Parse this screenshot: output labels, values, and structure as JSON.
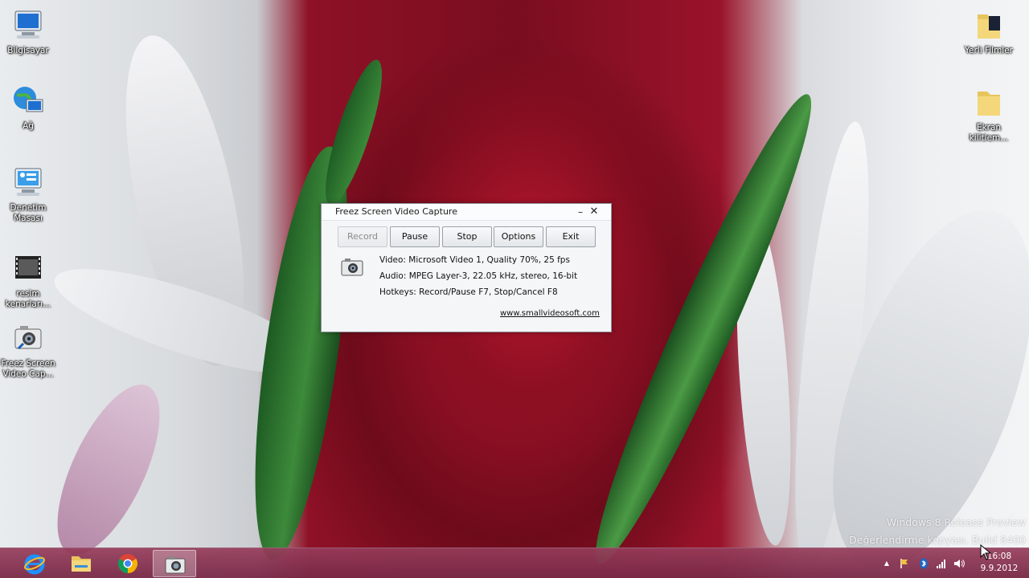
{
  "desktop": {
    "icons_left": [
      {
        "label": "Bilgisayar",
        "icon": "computer-icon"
      },
      {
        "label": "Ağ",
        "icon": "network-globe-icon"
      },
      {
        "label": "Denetim\nMasası",
        "icon": "control-panel-icon"
      },
      {
        "label": "resim\nkenarları...",
        "icon": "video-file-icon"
      },
      {
        "label": "Freez Screen\nVideo Cap...",
        "icon": "camera-app-icon"
      }
    ],
    "icons_right": [
      {
        "label": "Yerli Filmler",
        "icon": "folder-icon"
      },
      {
        "label": "Ekran\nkilitlem...",
        "icon": "folder-icon"
      }
    ]
  },
  "dialog": {
    "title": "Freez Screen Video Capture",
    "minimize_symbol": "–",
    "close_symbol": "✕",
    "buttons": {
      "record": "Record",
      "pause": "Pause",
      "stop": "Stop",
      "options": "Options",
      "exit": "Exit"
    },
    "record_disabled": true,
    "video_info": "Video: Microsoft Video 1, Quality 70%, 25 fps",
    "audio_info": "Audio: MPEG Layer-3, 22.05 kHz, stereo, 16-bit",
    "hotkeys_info": "Hotkeys: Record/Pause F7, Stop/Cancel F8",
    "website": "www.smallvideosoft.com"
  },
  "watermark": {
    "line1": "Windows 8 Release Preview",
    "line2": "Değerlendirme kopyası. Build 8400"
  },
  "taskbar": {
    "apps": [
      {
        "name": "internet-explorer",
        "active": false
      },
      {
        "name": "file-explorer",
        "active": false
      },
      {
        "name": "chrome",
        "active": false
      },
      {
        "name": "freez-screen-video-capture",
        "active": true
      }
    ],
    "tray_up_arrow": "▲",
    "time": "16:08",
    "date": "9.9.2012"
  },
  "colors": {
    "taskbar": "#8a3358",
    "dialog_bg": "#f5f6f8",
    "rose": "#8c0f22"
  }
}
